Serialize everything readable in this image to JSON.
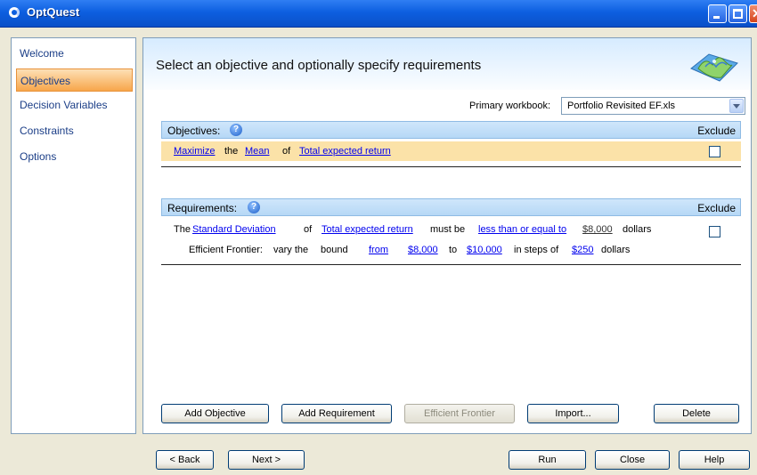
{
  "window": {
    "title": "OptQuest"
  },
  "sidebar": {
    "items": [
      {
        "label": "Welcome",
        "active": false
      },
      {
        "label": "Objectives",
        "active": true
      },
      {
        "label": "Decision Variables",
        "active": false
      },
      {
        "label": "Constraints",
        "active": false
      },
      {
        "label": "Options",
        "active": false
      }
    ]
  },
  "header": {
    "title": "Select an objective and optionally specify requirements"
  },
  "workbook": {
    "label": "Primary workbook:",
    "value": "Portfolio Revisited EF.xls"
  },
  "objectives": {
    "title": "Objectives:",
    "exclude_label": "Exclude",
    "row": {
      "goal": "Maximize",
      "the": "the",
      "statistic": "Mean",
      "of": "of",
      "forecast": "Total expected return",
      "excluded": false
    }
  },
  "requirements": {
    "title": "Requirements:",
    "exclude_label": "Exclude",
    "row1": {
      "the": "The",
      "statistic": "Standard Deviation",
      "of": "of",
      "forecast": "Total expected return",
      "must_be": "must be",
      "operator": "less than or equal to",
      "bound": "$8,000",
      "unit": "dollars",
      "excluded": false
    },
    "row2": {
      "ef_label": "Efficient Frontier:",
      "vary_text": "vary the",
      "bound_word": "bound",
      "from_link": "from",
      "from_value": "$8,000",
      "to_word": "to",
      "to_value": "$10,000",
      "steps_text": "in steps of",
      "step_value": "$250",
      "unit": "dollars"
    }
  },
  "buttons": {
    "add_objective": "Add Objective",
    "add_requirement": "Add Requirement",
    "efficient_frontier": "Efficient Frontier",
    "import": "Import...",
    "delete": "Delete"
  },
  "footer": {
    "back": "< Back",
    "next": "Next >",
    "run": "Run",
    "close": "Close",
    "help": "Help"
  },
  "colors": {
    "titlebar": "#0d5fe0",
    "active_nav": "#f7a64b",
    "objective_row": "#fbe2a8",
    "section_header": "#b6d8f6",
    "link": "#0000ee"
  }
}
